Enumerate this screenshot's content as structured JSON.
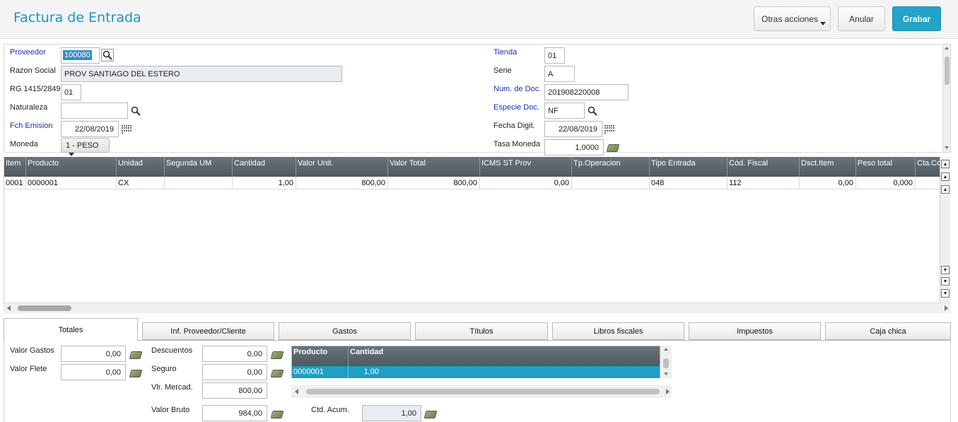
{
  "header": {
    "title": "Factura de Entrada",
    "other_actions_label": "Otras acciones",
    "cancel_label": "Anular",
    "save_label": "Grabar"
  },
  "form": {
    "proveedor": {
      "label": "Proveedor",
      "value": "100080"
    },
    "razon_social": {
      "label": "Razon Social",
      "value": "PROV SANTIAGO DEL ESTERO"
    },
    "rg": {
      "label": "RG 1415/2849",
      "value": "01"
    },
    "naturaleza": {
      "label": "Naturaleza",
      "value": ""
    },
    "fch_emision": {
      "label": "Fch Emision",
      "value": "22/08/2019"
    },
    "moneda": {
      "label": "Moneda",
      "value": "1 - PESO"
    },
    "tienda": {
      "label": "Tienda",
      "value": "01"
    },
    "serie": {
      "label": "Serie",
      "value": "A"
    },
    "num_doc": {
      "label": "Num. de Doc.",
      "value": "201908220008"
    },
    "especie_doc": {
      "label": "Especie Doc.",
      "value": "NF"
    },
    "fecha_digit": {
      "label": "Fecha Digit.",
      "value": "22/08/2019"
    },
    "tasa_moneda": {
      "label": "Tasa Moneda",
      "value": "1,0000"
    }
  },
  "items_grid": {
    "columns": [
      "Item",
      "Producto",
      "Unidad",
      "Segunda UM",
      "Cantidad",
      "Valor Unit.",
      "Valor Total",
      "ICMS ST Prov",
      "Tp.Operacion",
      "Tipo Entrada",
      "Cód. Fiscal",
      "Dsct.Item",
      "Peso total",
      "Cta.Co"
    ],
    "rows": [
      [
        "0001",
        "0000001",
        "CX",
        "",
        "1,00",
        "800,00",
        "800,00",
        "0,00",
        "",
        "048",
        "112",
        "0,00",
        "0,000",
        ""
      ]
    ]
  },
  "tabs": [
    "Totales",
    "Inf. Proveedor/Cliente",
    "Gastos",
    "Títulos",
    "Libros fiscales",
    "Impuestos",
    "Caja chica"
  ],
  "totals": {
    "valor_gastos": {
      "label": "Valor Gastos",
      "value": "0,00"
    },
    "valor_flete": {
      "label": "Valor Flete",
      "value": "0,00"
    },
    "descuentos": {
      "label": "Descuentos",
      "value": "0,00"
    },
    "seguro": {
      "label": "Seguro",
      "value": "0,00"
    },
    "vlr_mercad": {
      "label": "Vlr. Mercad.",
      "value": "800,00"
    },
    "valor_bruto": {
      "label": "Valor Bruto",
      "value": "984,00"
    },
    "ctd_acum": {
      "label": "Ctd. Acum.",
      "value": "1,00"
    }
  },
  "mini_grid": {
    "columns": [
      "Producto",
      "Cantidad"
    ],
    "rows": [
      [
        "0000001",
        "1,00"
      ]
    ]
  }
}
